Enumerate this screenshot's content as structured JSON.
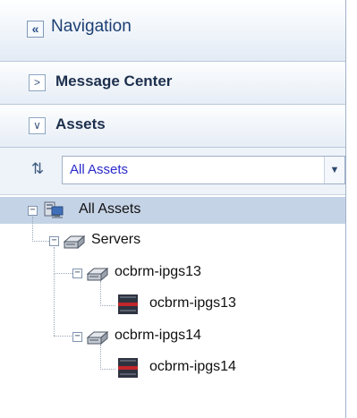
{
  "navigation": {
    "title": "Navigation",
    "collapse_icon": "double-chevron-left-icon"
  },
  "sections": [
    {
      "label": "Message Center",
      "state": "collapsed"
    },
    {
      "label": "Assets",
      "state": "expanded"
    }
  ],
  "assets_filter": {
    "selected": "All Assets"
  },
  "tree": {
    "root": {
      "label": "All Assets",
      "selected": true
    },
    "servers": {
      "label": "Servers"
    },
    "hosts": [
      {
        "label": "ocbrm-ipgs13",
        "child": "ocbrm-ipgs13"
      },
      {
        "label": "ocbrm-ipgs14",
        "child": "ocbrm-ipgs14"
      }
    ]
  },
  "colors": {
    "panel_bg": "#e9f0f8",
    "selected_row": "#c5d3e6",
    "link_blue": "#2a2acc",
    "title_blue": "#1b3f73"
  }
}
